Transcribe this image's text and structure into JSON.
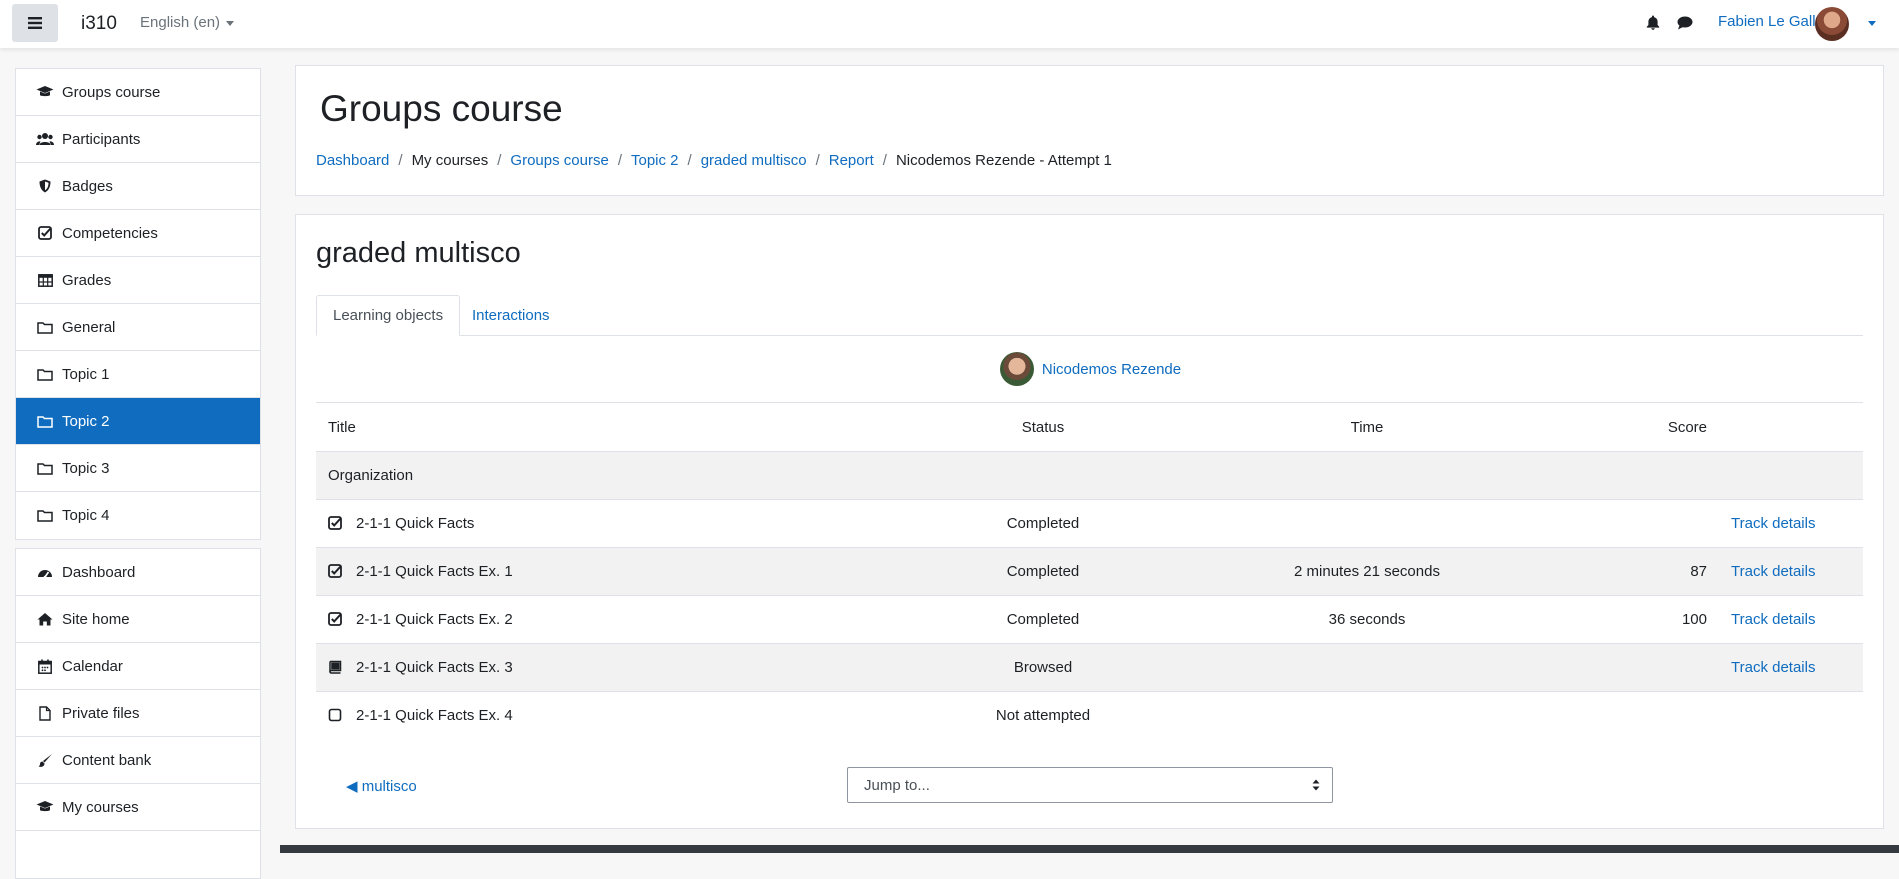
{
  "navbar": {
    "site_name": "i310",
    "language": "English (en)",
    "user_name": "Fabien Le Gall"
  },
  "sidebar": {
    "course_items": [
      {
        "label": "Groups course",
        "icon": "graduation-cap-icon"
      },
      {
        "label": "Participants",
        "icon": "users-icon"
      },
      {
        "label": "Badges",
        "icon": "shield-icon"
      },
      {
        "label": "Competencies",
        "icon": "check-square-icon"
      },
      {
        "label": "Grades",
        "icon": "table-icon"
      },
      {
        "label": "General",
        "icon": "folder-icon"
      },
      {
        "label": "Topic 1",
        "icon": "folder-icon"
      },
      {
        "label": "Topic 2",
        "icon": "folder-icon",
        "active": true
      },
      {
        "label": "Topic 3",
        "icon": "folder-icon"
      },
      {
        "label": "Topic 4",
        "icon": "folder-icon"
      }
    ],
    "site_items": [
      {
        "label": "Dashboard",
        "icon": "dashboard-icon"
      },
      {
        "label": "Site home",
        "icon": "home-icon"
      },
      {
        "label": "Calendar",
        "icon": "calendar-icon"
      },
      {
        "label": "Private files",
        "icon": "file-icon"
      },
      {
        "label": "Content bank",
        "icon": "paint-brush-icon"
      },
      {
        "label": "My courses",
        "icon": "graduation-cap-icon"
      }
    ]
  },
  "header": {
    "title": "Groups course",
    "breadcrumb": [
      "Dashboard",
      "My courses",
      "Groups course",
      "Topic 2",
      "graded multisco",
      "Report",
      "Nicodemos Rezende - Attempt 1"
    ]
  },
  "activity": {
    "title": "graded multisco",
    "tabs": [
      "Learning objects",
      "Interactions"
    ],
    "user": "Nicodemos Rezende",
    "table": {
      "headers": [
        "Title",
        "Status",
        "Time",
        "Score"
      ],
      "group_row": "Organization",
      "rows": [
        {
          "title": "2-1-1 Quick Facts",
          "status": "Completed",
          "time": "",
          "score": "",
          "link": "Track details",
          "icon": "checked-square-icon"
        },
        {
          "title": "2-1-1 Quick Facts Ex. 1",
          "status": "Completed",
          "time": "2 minutes 21 seconds",
          "score": "87",
          "link": "Track details",
          "icon": "checked-square-icon"
        },
        {
          "title": "2-1-1 Quick Facts Ex. 2",
          "status": "Completed",
          "time": "36 seconds",
          "score": "100",
          "link": "Track details",
          "icon": "checked-square-icon"
        },
        {
          "title": "2-1-1 Quick Facts Ex. 3",
          "status": "Browsed",
          "time": "",
          "score": "",
          "link": "Track details",
          "icon": "book-icon"
        },
        {
          "title": "2-1-1 Quick Facts Ex. 4",
          "status": "Not attempted",
          "time": "",
          "score": "",
          "link": "",
          "icon": "empty-square-icon"
        }
      ]
    },
    "prev_link": "◀ multisco",
    "jump_select": "Jump to..."
  },
  "colors": {
    "accent": "#0f6cbf",
    "stripe": "#f2f2f2",
    "border": "#dee2e6"
  }
}
